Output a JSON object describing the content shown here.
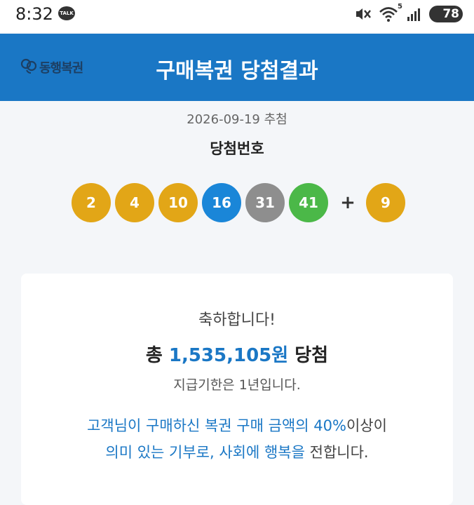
{
  "status_bar": {
    "time": "8:32",
    "talk_badge": "TALK",
    "network": "5",
    "battery": "78"
  },
  "header": {
    "logo_text": "동행복권",
    "title": "구매복권 당첨결과"
  },
  "draw": {
    "date_text": "2026-09-19 추첨",
    "numbers_title": "당첨번호",
    "balls": [
      {
        "number": "2",
        "color": "#e2a617"
      },
      {
        "number": "4",
        "color": "#e2a617"
      },
      {
        "number": "10",
        "color": "#e2a617"
      },
      {
        "number": "16",
        "color": "#1a86d8"
      },
      {
        "number": "31",
        "color": "#8e8e8e"
      },
      {
        "number": "41",
        "color": "#4bb848"
      }
    ],
    "plus": "+",
    "bonus": {
      "number": "9",
      "color": "#e2a617"
    }
  },
  "result": {
    "congrats": "축하합니다!",
    "total_prefix": "총 ",
    "amount": "1,535,105원",
    "total_suffix": " 당첨",
    "deadline": "지급기한은 1년입니다.",
    "donation_line1_a": "고객님이 구매하신 복권 구매 금액의 40%",
    "donation_line1_b": "이상이",
    "donation_line2_a": "의미 있는 기부로, 사회에 행복을",
    "donation_line2_b": " 전합니다."
  },
  "colors": {
    "header_bg": "#1a77c5",
    "accent": "#1a77c5"
  }
}
